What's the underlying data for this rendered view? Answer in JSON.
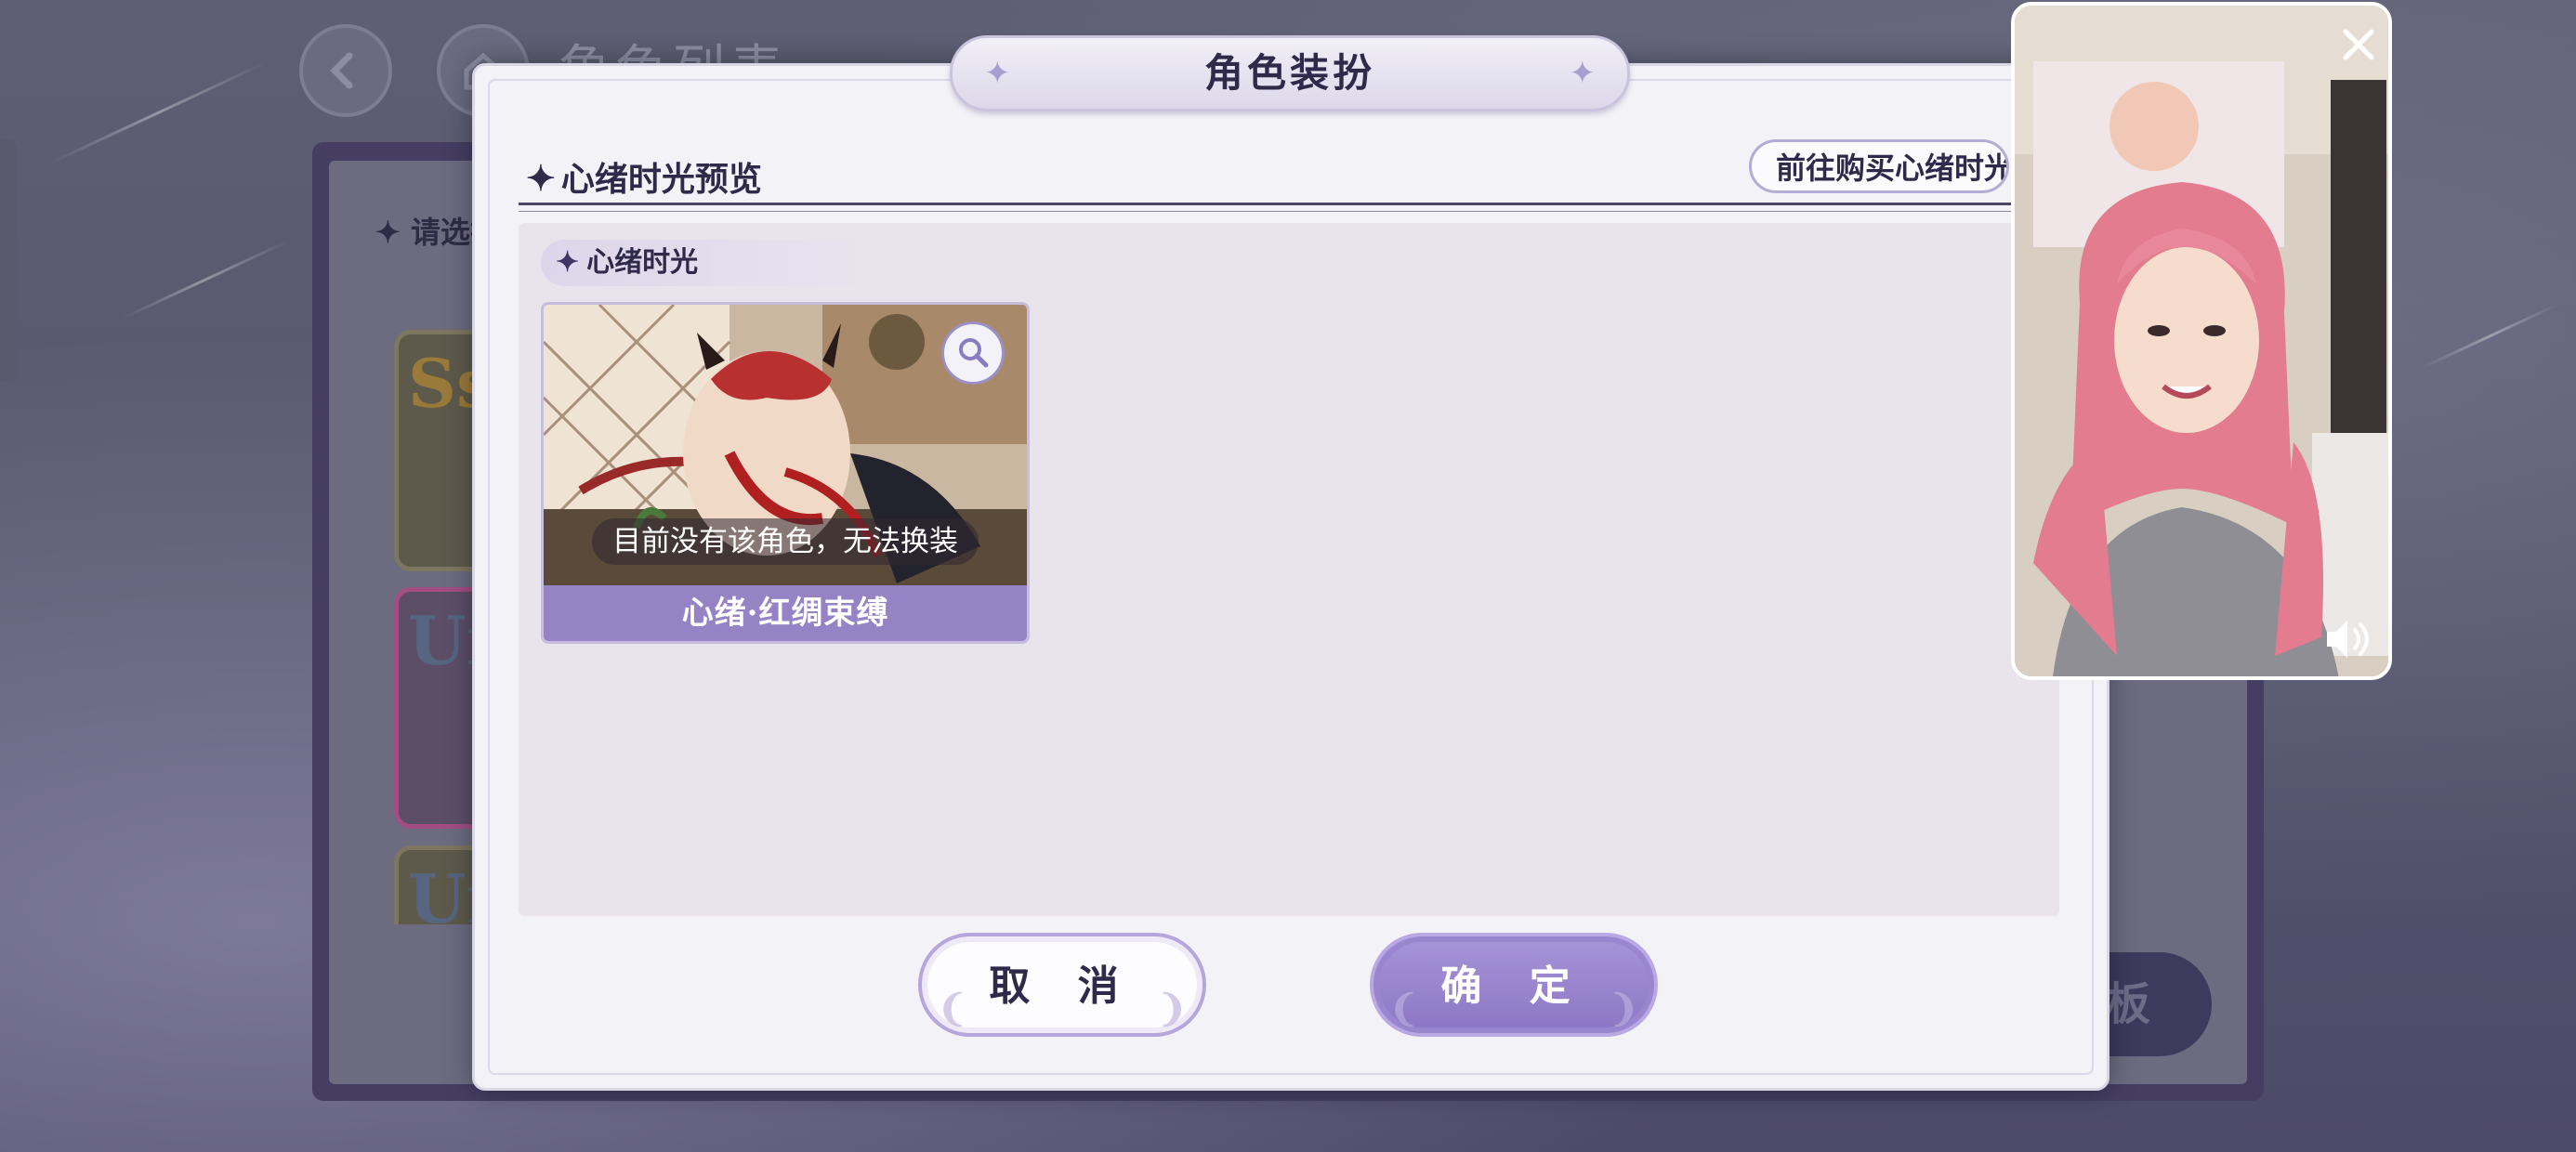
{
  "background": {
    "title": "角色列表",
    "header_label": "请选择",
    "card_rarity_labels": [
      "Ssr",
      "Ur",
      "Ur"
    ],
    "board_button_label": "板"
  },
  "dialog": {
    "title": "角色装扮",
    "section_title": "心绪时光预览",
    "buy_button_label": "前往购买心绪时光",
    "category_tag": "心绪时光",
    "card": {
      "name": "心绪·红绸束缚",
      "notice": "目前没有该角色，无法换装"
    },
    "cancel_label": "取 消",
    "confirm_label": "确 定"
  },
  "icons": {
    "back": "back-arrow-icon",
    "home": "home-icon",
    "zoom": "magnifier-icon",
    "close": "close-icon",
    "sound": "speaker-icon",
    "sparkle": "sparkle-icon"
  },
  "colors": {
    "accent": "#9683c6",
    "dialog_bg": "#f3f2f6",
    "title_text": "#2f2a4a"
  }
}
